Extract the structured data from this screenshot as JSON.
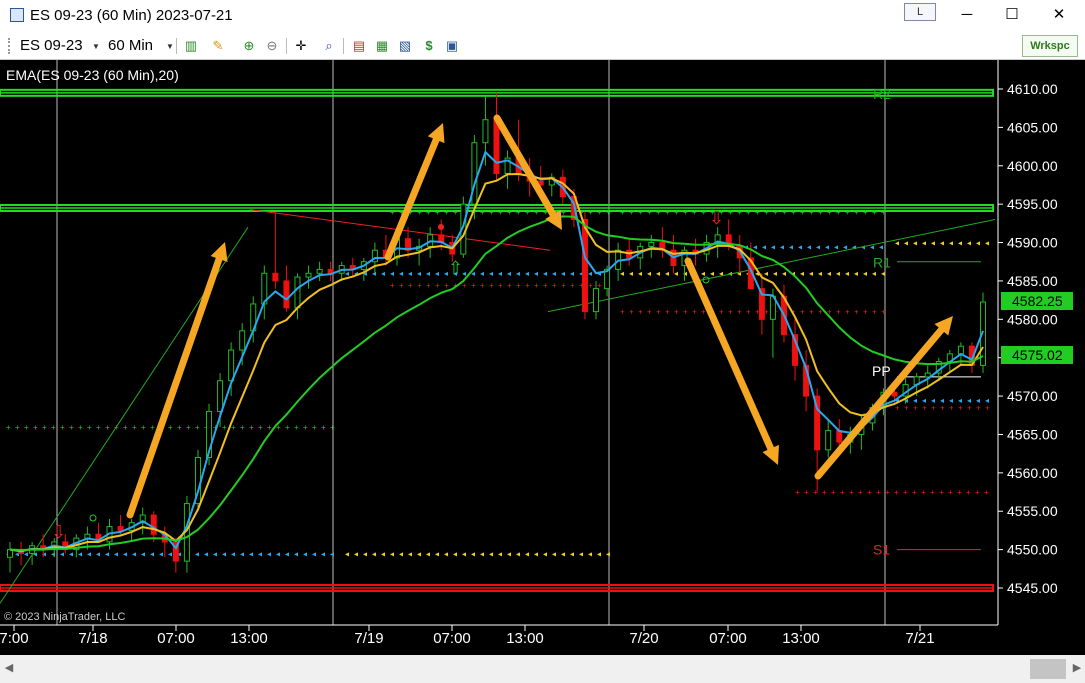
{
  "window": {
    "title": "ES 09-23 (60 Min)  2023-07-21",
    "link_button": "L",
    "minimize": "─",
    "maximize": "☐",
    "close": "✕"
  },
  "toolbar": {
    "instrument": "ES 09-23",
    "period": "60 Min",
    "workspace_label": "Wrkspc",
    "icons": [
      "bar-style-icon",
      "draw-pencil-icon",
      "zoom-in-icon",
      "zoom-out-icon",
      "crosshair-icon",
      "magnify-icon",
      "indicators-icon",
      "strategies-icon",
      "chart-trader-icon",
      "dollar-icon",
      "properties-icon"
    ]
  },
  "chart_data": {
    "type": "candlestick",
    "indicator_label": "EMA(ES 09-23 (60 Min),20)",
    "copyright": "© 2023 NinjaTrader, LLC",
    "price_axis": {
      "ticks": [
        "4610.00",
        "4605.00",
        "4600.00",
        "4595.00",
        "4590.00",
        "4585.00",
        "4580.00",
        "4575.00",
        "4570.00",
        "4565.00",
        "4560.00",
        "4555.00",
        "4550.00",
        "4545.00"
      ],
      "range": [
        4543,
        4612
      ]
    },
    "time_axis": {
      "ticks": [
        "7:00",
        "7/18",
        "07:00",
        "13:00",
        "7/19",
        "07:00",
        "13:00",
        "7/20",
        "07:00",
        "13:00",
        "7/21"
      ]
    },
    "last_price_label": "4582.25",
    "ema_price_label": "4575.02",
    "pivot_labels": [
      "R2",
      "R1",
      "PP",
      "S1"
    ],
    "pivot_values": {
      "R2": 4609.5,
      "R1": 4587.5,
      "PP": 4572.5,
      "S1": 4550.0
    },
    "horizontal_lines": [
      {
        "price": 4609.5,
        "color": "#22dd22"
      },
      {
        "price": 4594.5,
        "color": "#22dd22"
      },
      {
        "price": 4545.0,
        "color": "#ee1111"
      }
    ],
    "colors": {
      "up_candle": "#22bb22",
      "down_candle": "#ee1111",
      "ema_fast": "#29a8f0",
      "ema_mid": "#f0c020",
      "ema_slow": "#22cc22",
      "arrow": "#f5a623",
      "last_price_bg": "#22cc22",
      "axis_text": "#ffffff"
    },
    "candles": [
      [
        4549,
        4551,
        4547,
        4550
      ],
      [
        4550,
        4551,
        4548,
        4549.5
      ],
      [
        4549.5,
        4551,
        4548,
        4550.5
      ],
      [
        4550.5,
        4552,
        4549,
        4550
      ],
      [
        4550,
        4551.5,
        4549,
        4551
      ],
      [
        4551,
        4552,
        4549.5,
        4550
      ],
      [
        4550,
        4552,
        4549,
        4551.5
      ],
      [
        4551.5,
        4553,
        4550,
        4552
      ],
      [
        4552,
        4553.5,
        4551,
        4551
      ],
      [
        4551,
        4554,
        4550,
        4553
      ],
      [
        4553,
        4554.5,
        4552,
        4552.5
      ],
      [
        4552.5,
        4554,
        4551,
        4553.5
      ],
      [
        4553.5,
        4555.5,
        4552,
        4554.5
      ],
      [
        4554.5,
        4555,
        4551,
        4552
      ],
      [
        4552,
        4553,
        4549,
        4551
      ],
      [
        4551,
        4551.5,
        4547,
        4548.5
      ],
      [
        4548.5,
        4557,
        4547,
        4556
      ],
      [
        4556,
        4563,
        4555,
        4562
      ],
      [
        4562,
        4569,
        4561,
        4568
      ],
      [
        4568,
        4573,
        4566,
        4572
      ],
      [
        4572,
        4577,
        4570,
        4576
      ],
      [
        4576,
        4579.5,
        4574,
        4578.5
      ],
      [
        4578.5,
        4583,
        4577,
        4582
      ],
      [
        4582,
        4587,
        4580,
        4586
      ],
      [
        4586,
        4594,
        4584,
        4585
      ],
      [
        4585,
        4587,
        4581,
        4581.5
      ],
      [
        4581.5,
        4586,
        4580,
        4585.5
      ],
      [
        4585.5,
        4587,
        4584,
        4586
      ],
      [
        4586,
        4587.5,
        4585,
        4586.5
      ],
      [
        4586.5,
        4587.5,
        4585,
        4586
      ],
      [
        4586,
        4587.5,
        4585,
        4587
      ],
      [
        4587,
        4588,
        4585.5,
        4586.5
      ],
      [
        4586.5,
        4588,
        4585,
        4587.5
      ],
      [
        4587.5,
        4590,
        4586,
        4589
      ],
      [
        4589,
        4591,
        4587,
        4588
      ],
      [
        4588,
        4591,
        4587,
        4590.5
      ],
      [
        4590.5,
        4592,
        4588,
        4589
      ],
      [
        4589,
        4590.5,
        4587,
        4589.5
      ],
      [
        4589.5,
        4592,
        4588,
        4591
      ],
      [
        4591,
        4593,
        4589,
        4590
      ],
      [
        4590,
        4591,
        4587.5,
        4588.5
      ],
      [
        4588.5,
        4596,
        4588,
        4595
      ],
      [
        4595,
        4604,
        4593,
        4603
      ],
      [
        4603,
        4609,
        4600,
        4606
      ],
      [
        4606,
        4609.5,
        4598,
        4599
      ],
      [
        4599,
        4602,
        4597,
        4601
      ],
      [
        4601,
        4606,
        4598,
        4599
      ],
      [
        4599,
        4601,
        4596,
        4598
      ],
      [
        4598,
        4600,
        4596,
        4597.5
      ],
      [
        4597.5,
        4599,
        4596,
        4598.5
      ],
      [
        4598.5,
        4599.5,
        4595,
        4596
      ],
      [
        4596,
        4597,
        4592,
        4593
      ],
      [
        4593,
        4594,
        4580,
        4581
      ],
      [
        4581,
        4585,
        4580,
        4584
      ],
      [
        4584,
        4587,
        4583,
        4586.5
      ],
      [
        4586.5,
        4590,
        4585,
        4589
      ],
      [
        4589,
        4590.5,
        4587,
        4588
      ],
      [
        4588,
        4590,
        4586.5,
        4589.5
      ],
      [
        4589.5,
        4591,
        4588,
        4590
      ],
      [
        4590,
        4592,
        4588,
        4589
      ],
      [
        4589,
        4591,
        4586,
        4587
      ],
      [
        4587,
        4589.5,
        4585,
        4589
      ],
      [
        4589,
        4590.5,
        4587,
        4588.5
      ],
      [
        4588.5,
        4591,
        4587.5,
        4590
      ],
      [
        4590,
        4592,
        4588,
        4591
      ],
      [
        4591,
        4593,
        4589,
        4589.5
      ],
      [
        4589.5,
        4591,
        4586,
        4588
      ],
      [
        4588,
        4590,
        4585,
        4584
      ],
      [
        4584,
        4586,
        4578,
        4580
      ],
      [
        4580,
        4584,
        4575,
        4583
      ],
      [
        4583,
        4584.5,
        4577,
        4578
      ],
      [
        4578,
        4580,
        4572,
        4574
      ],
      [
        4574,
        4576,
        4568,
        4570
      ],
      [
        4570,
        4571,
        4557.5,
        4563
      ],
      [
        4563,
        4567,
        4562,
        4565.5
      ],
      [
        4565.5,
        4567,
        4563,
        4564
      ],
      [
        4564,
        4566,
        4562.5,
        4565
      ],
      [
        4565,
        4567.5,
        4563,
        4566.5
      ],
      [
        4566.5,
        4569,
        4565.5,
        4568.5
      ],
      [
        4568.5,
        4571,
        4567.5,
        4570.5
      ],
      [
        4570.5,
        4572,
        4569,
        4570
      ],
      [
        4570,
        4572.5,
        4569,
        4571.5
      ],
      [
        4571.5,
        4573,
        4570,
        4572.5
      ],
      [
        4572.5,
        4574,
        4571,
        4573
      ],
      [
        4573,
        4575,
        4572,
        4574.5
      ],
      [
        4574.5,
        4576,
        4573,
        4575.5
      ],
      [
        4575.5,
        4577,
        4574,
        4576.5
      ],
      [
        4576.5,
        4577,
        4573,
        4574
      ],
      [
        4574,
        4583.5,
        4573,
        4582.25
      ]
    ]
  }
}
